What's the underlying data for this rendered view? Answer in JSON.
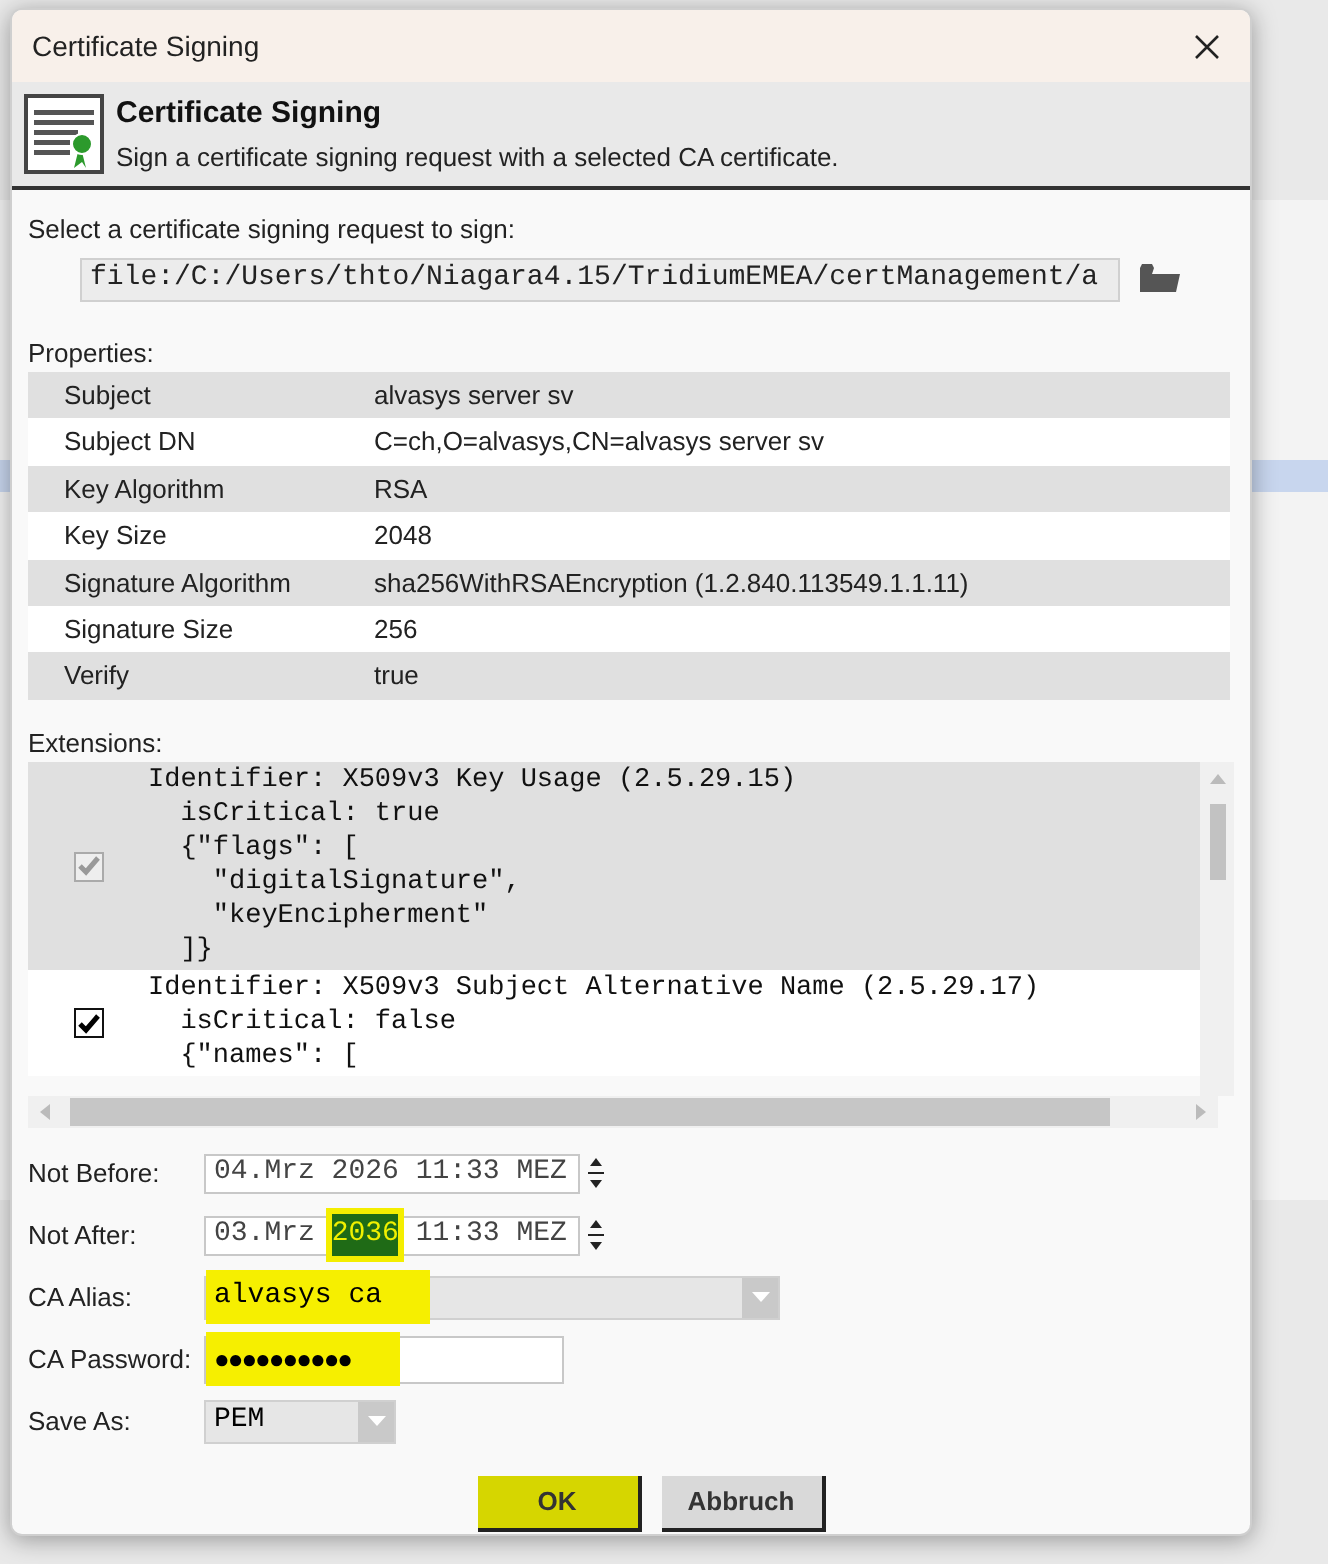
{
  "window": {
    "title": "Certificate Signing"
  },
  "header": {
    "title": "Certificate Signing",
    "subtitle": "Sign a certificate signing request with a selected CA certificate."
  },
  "request": {
    "label": "Select a certificate signing request to sign:",
    "value": "file:/C:/Users/thto/Niagara4.15/TridiumEMEA/certManagement/a"
  },
  "properties": {
    "label": "Properties:",
    "rows": [
      {
        "name": "Subject",
        "value": "alvasys server sv"
      },
      {
        "name": "Subject DN",
        "value": "C=ch,O=alvasys,CN=alvasys server sv"
      },
      {
        "name": "Key Algorithm",
        "value": "RSA"
      },
      {
        "name": "Key Size",
        "value": "2048"
      },
      {
        "name": "Signature Algorithm",
        "value": "sha256WithRSAEncryption (1.2.840.113549.1.1.11)"
      },
      {
        "name": "Signature Size",
        "value": "256"
      },
      {
        "name": "Verify",
        "value": "true"
      }
    ]
  },
  "extensions": {
    "label": "Extensions:",
    "items": [
      {
        "checked": true,
        "disabled": true,
        "selected": true,
        "lines": [
          "Identifier: X509v3 Key Usage (2.5.29.15)",
          "  isCritical: true",
          "  {\"flags\": [",
          "    \"digitalSignature\",",
          "    \"keyEncipherment\"",
          "  ]}"
        ]
      },
      {
        "checked": true,
        "disabled": false,
        "selected": false,
        "lines": [
          "Identifier: X509v3 Subject Alternative Name (2.5.29.17)",
          "  isCritical: false",
          "  {\"names\": ["
        ]
      }
    ]
  },
  "form": [
    {
      "kind": "date",
      "label": "Not Before:",
      "parts": [
        {
          "text": "04.Mrz 2026 11:33 MEZ",
          "selected": false,
          "highlighted": false
        }
      ]
    },
    {
      "kind": "date",
      "label": "Not After:",
      "parts": [
        {
          "text": "03.Mrz ",
          "selected": false,
          "highlighted": false
        },
        {
          "text": "2036",
          "selected": true,
          "highlighted": true
        },
        {
          "text": " 11:33 MEZ",
          "selected": false,
          "highlighted": false
        }
      ]
    },
    {
      "kind": "combo",
      "label": "CA Alias:",
      "value": "alvasys ca",
      "highlighted": true
    },
    {
      "kind": "password",
      "label": "CA Password:",
      "value": "●●●●●●●●●●",
      "highlighted": true
    },
    {
      "kind": "select",
      "label": "Save As:",
      "value": "PEM",
      "highlighted": false
    }
  ],
  "buttons": [
    {
      "label": "OK",
      "highlighted": true
    },
    {
      "label": "Abbruch",
      "highlighted": false
    }
  ]
}
